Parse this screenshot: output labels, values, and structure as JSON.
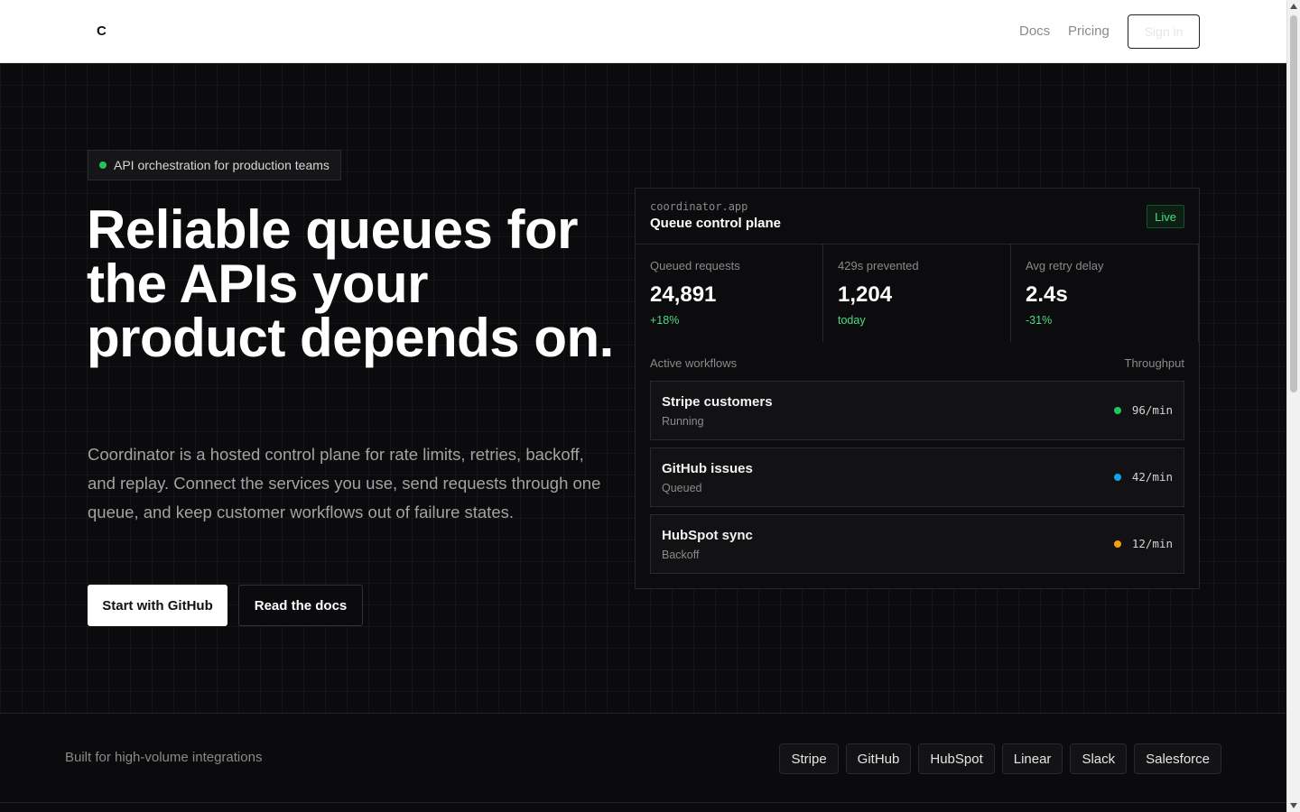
{
  "header": {
    "logo": "C",
    "nav": [
      "Docs",
      "Pricing"
    ],
    "signin_label": "Sign in"
  },
  "hero": {
    "pill_text": "API orchestration for production teams",
    "headline": "Reliable queues for the APIs your product depends on.",
    "subhead": "Coordinator is a hosted control plane for rate limits, retries, backoff, and replay. Connect the services you use, send requests through one queue, and keep customer workflows out of failure states.",
    "primary_cta": "Start with GitHub",
    "secondary_cta": "Read the docs"
  },
  "panel": {
    "domain": "coordinator.app",
    "title": "Queue control plane",
    "badge": "Live",
    "stats": [
      {
        "label": "Queued requests",
        "value": "24,891",
        "delta": "+18%"
      },
      {
        "label": "429s prevented",
        "value": "1,204",
        "delta": "today"
      },
      {
        "label": "Avg retry delay",
        "value": "2.4s",
        "delta": "-31%"
      }
    ],
    "workflows_label": "Active workflows",
    "throughput_label": "Throughput",
    "workflows": [
      {
        "name": "Stripe customers",
        "status": "Running",
        "rate": "96/min",
        "color": "#22c55e"
      },
      {
        "name": "GitHub issues",
        "status": "Queued",
        "rate": "42/min",
        "color": "#0ea5e9"
      },
      {
        "name": "HubSpot sync",
        "status": "Backoff",
        "rate": "12/min",
        "color": "#f59e0b"
      }
    ]
  },
  "integrations": {
    "label": "Built for high-volume integrations",
    "items": [
      "Stripe",
      "GitHub",
      "HubSpot",
      "Linear",
      "Slack",
      "Salesforce"
    ]
  },
  "colors": {
    "accent_green": "#22c55e",
    "background": "#0b0b0d"
  }
}
